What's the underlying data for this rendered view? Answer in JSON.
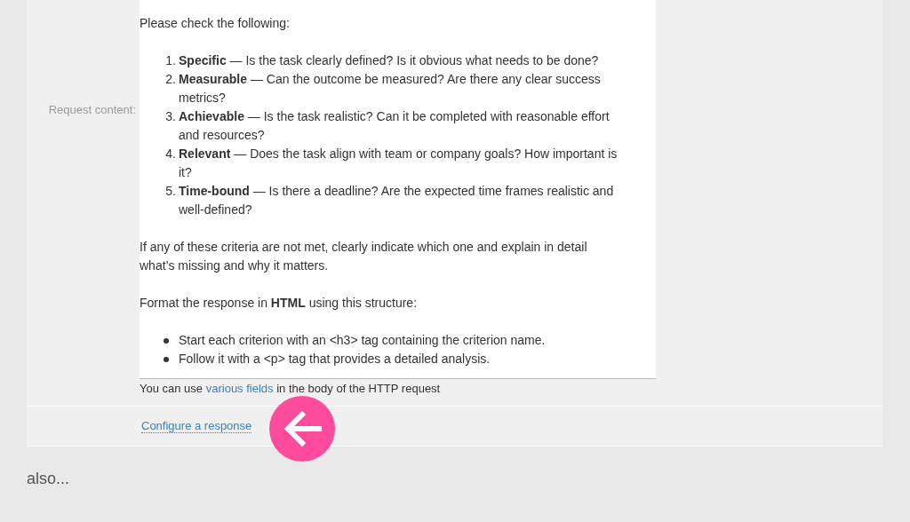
{
  "request_content": {
    "label": "Request content:",
    "blocks": [
      {
        "kind": "paragraph",
        "text": "Please check the following:"
      },
      {
        "kind": "ordered",
        "items": [
          {
            "marker": "1.",
            "text": "**Specific** — Is the task clearly defined? Is it obvious what needs to be done?"
          },
          {
            "marker": "2.",
            "text": "**Measurable** — Can the outcome be measured? Are there any clear success metrics?"
          },
          {
            "marker": "3.",
            "text": "**Achievable** — Is the task realistic? Can it be completed with reasonable effort and resources?"
          },
          {
            "marker": "4.",
            "text": "**Relevant** — Does the task align with team or company goals? How important is it?"
          },
          {
            "marker": "5.",
            "text": "**Time-bound** — Is there a deadline? Are the expected time frames realistic and well-defined?"
          }
        ]
      },
      {
        "kind": "paragraph",
        "text": "If any of these criteria are not met, clearly indicate which one and explain in detail what’s missing and why it matters."
      },
      {
        "kind": "paragraph",
        "text": "Format the response in **HTML** using this structure:"
      },
      {
        "kind": "bulleted",
        "items": [
          {
            "text": "Start each criterion with an <h3> tag containing the criterion name."
          },
          {
            "text": "Follow it with a <p> tag that provides a detailed analysis."
          }
        ]
      }
    ],
    "hint": {
      "before": "You can use ",
      "link": "various fields",
      "after": " in the body of the HTTP request"
    }
  },
  "configure_link": "Configure a response",
  "footer_text": "also..."
}
